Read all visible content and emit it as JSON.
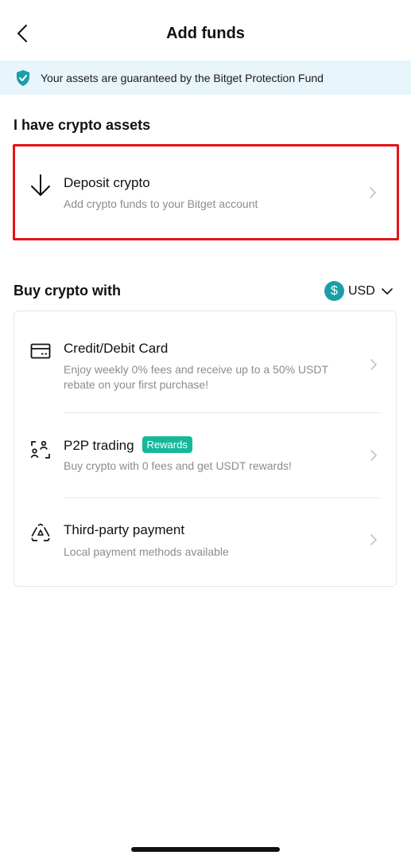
{
  "header": {
    "title": "Add funds",
    "back_icon": "chevron-left-icon"
  },
  "banner": {
    "text": "Your assets are guaranteed by the Bitget Protection Fund",
    "icon": "shield-check-icon",
    "bg_color": "#e8f5fa",
    "icon_color": "#1a9fa8"
  },
  "crypto_section": {
    "title": "I have crypto assets",
    "deposit": {
      "title": "Deposit crypto",
      "desc": "Add crypto funds to your Bitget account",
      "icon": "arrow-down-icon",
      "highlight_color": "#e3141a"
    }
  },
  "buy_section": {
    "title": "Buy crypto with",
    "currency": {
      "symbol": "$",
      "label": "USD"
    },
    "options": [
      {
        "title": "Credit/Debit Card",
        "desc_line1": "Enjoy weekly 0% fees and receive up to a 50% USDT",
        "desc_line2": "rebate on your first purchase!",
        "icon": "credit-card-icon"
      },
      {
        "title": "P2P trading",
        "badge": "Rewards",
        "desc_line1": "Buy crypto with 0 fees and get USDT rewards!",
        "icon": "p2p-users-icon"
      },
      {
        "title": "Third-party payment",
        "desc_line1": "Local payment methods available",
        "icon": "third-party-icon"
      }
    ]
  },
  "colors": {
    "accent": "#1a9fa8",
    "badge": "#15b99a"
  }
}
